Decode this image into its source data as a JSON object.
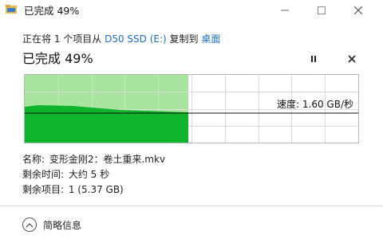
{
  "window": {
    "title": "已完成 49%",
    "icons": {
      "app": "folder-copy-icon",
      "minimize": "minimize-icon",
      "maximize": "maximize-icon",
      "close": "close-icon"
    }
  },
  "copy": {
    "prefix": "正在将 1 个项目从 ",
    "source": "D50 SSD (E:)",
    "middle": " 复制到 ",
    "destination": "桌面"
  },
  "progress": {
    "title": "已完成 49%",
    "fraction": 0.49,
    "pause_icon": "pause-icon",
    "cancel_icon": "cancel-icon",
    "speed_label": "速度: 1.60 GB/秒",
    "colors": {
      "filled_bg": "#a8e6a0",
      "speed_area": "#0fb42c",
      "grid": "#c8e8c4",
      "unfilled_grid": "#dcdcdc"
    }
  },
  "details": {
    "name_label": "名称: ",
    "name_value": "变形金刚2：卷土重来.mkv",
    "time_label": "剩余时间: ",
    "time_value": "大约 5 秒",
    "items_label": "剩余项目: ",
    "items_value": "1 (5.37 GB)"
  },
  "footer": {
    "toggle_label": "简略信息",
    "toggle_icon": "chevron-up-icon"
  }
}
